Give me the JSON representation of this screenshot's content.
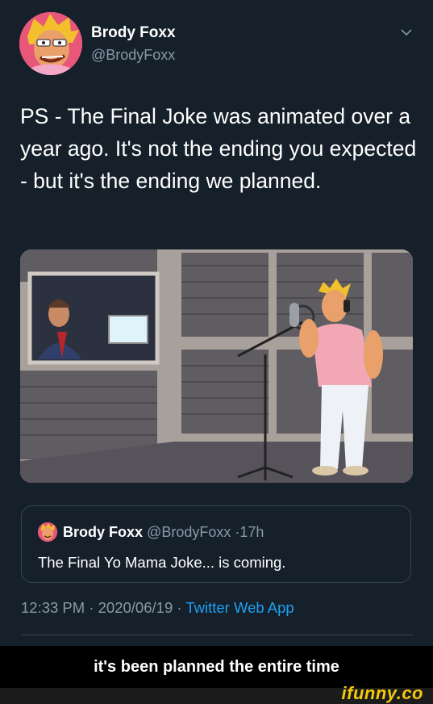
{
  "tweet": {
    "author_name": "Brody Foxx",
    "author_handle": "@BrodyFoxx",
    "menu_icon": "chevron-down-icon",
    "text": "PS - The Final Joke was animated over a year ago. It's not the ending you expected - but it's the ending we planned.",
    "media_icon": "cartoon-recording-studio-image",
    "quoted": {
      "author_name": "Brody Foxx",
      "author_handle": "@BrodyFoxx",
      "separator": "·",
      "age": "17h",
      "text": "The Final Yo Mama Joke... is coming."
    },
    "time": "12:33 PM",
    "date": "2020/06/19",
    "dot": "·",
    "source": "Twitter Web App"
  },
  "caption": "it's been planned the entire time",
  "watermark": "ifunny.co",
  "colors": {
    "background": "#15202b",
    "secondary_text": "#8899a6",
    "link": "#1da1f2",
    "border": "#38444d",
    "watermark": "#f3c90a"
  }
}
